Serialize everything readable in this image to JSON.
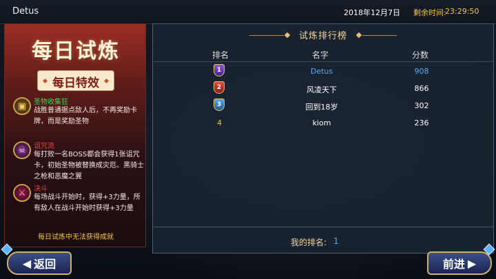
{
  "topbar": {
    "player_name": "Detus",
    "date": "2018年12月7日",
    "remaining_label": "剩余时间:",
    "remaining_time": "23:29:50"
  },
  "left_panel": {
    "title": "每日试炼",
    "special_label": "每日特效",
    "effects": [
      {
        "name": "圣物收集狂",
        "icon": "treasure-chest-icon",
        "color": "#3ad45a",
        "desc": "战胜普通据点敌人后，不再奖励卡牌，而是奖励圣物"
      },
      {
        "name": "诅咒流",
        "icon": "skull-icon",
        "color": "#e9413a",
        "desc": "每打败一名BOSS都会获得1张诅咒卡，初始圣物被替换成灾厄、黑骑士之枪和恶魔之翼"
      },
      {
        "name": "决斗",
        "icon": "crossed-swords-icon",
        "color": "#e9413a",
        "desc": "每场战斗开始时，获得+3力量，所有敌人在战斗开始时获得+3力量"
      }
    ],
    "footer_note": "每日试炼中无法获得成就"
  },
  "leaderboard": {
    "title": "试炼排行榜",
    "columns": {
      "rank": "排名",
      "name": "名字",
      "score": "分数"
    },
    "rows": [
      {
        "rank": "1",
        "name": "Detus",
        "score": "908",
        "self": true
      },
      {
        "rank": "2",
        "name": "风凌天下",
        "score": "866",
        "self": false
      },
      {
        "rank": "3",
        "name": "回到18岁",
        "score": "302",
        "self": false
      },
      {
        "rank": "4",
        "name": "kiom",
        "score": "236",
        "self": false
      }
    ],
    "my_rank_label": "我的排名:",
    "my_rank_value": "1"
  },
  "buttons": {
    "back_label": "返回",
    "forward_label": "前进"
  },
  "colors": {
    "accent_gold": "#f2c545",
    "self_blue": "#58a9f5",
    "panel_red": "#9a2d24"
  }
}
